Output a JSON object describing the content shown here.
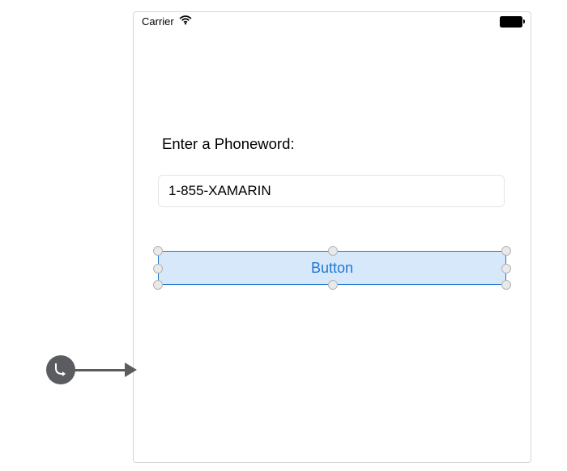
{
  "status": {
    "carrier": "Carrier"
  },
  "form": {
    "label": "Enter a Phoneword:",
    "input_value": "1-855-XAMARIN"
  },
  "button": {
    "label": "Button"
  }
}
